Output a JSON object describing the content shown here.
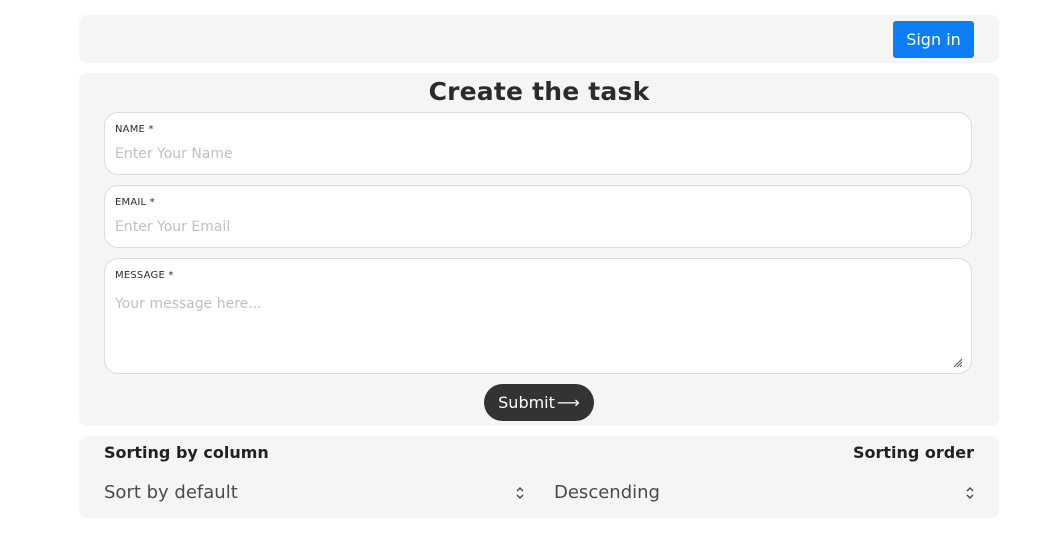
{
  "header": {
    "signin_label": "Sign in"
  },
  "form": {
    "title": "Create the task",
    "name": {
      "label": "NAME *",
      "placeholder": "Enter Your Name",
      "value": ""
    },
    "email": {
      "label": "EMAIL *",
      "placeholder": "Enter Your Email",
      "value": ""
    },
    "message": {
      "label": "MESSAGE *",
      "placeholder": "Your message here...",
      "value": ""
    },
    "submit_label": "Submit",
    "submit_arrow": "⟶"
  },
  "sorting": {
    "column_label": "Sorting by column",
    "column_value": "Sort by default",
    "order_label": "Sorting order",
    "order_value": "Descending"
  },
  "colors": {
    "primary_button": "#0d7ef7",
    "submit_button": "#333333",
    "card_background": "#f5f5f5"
  },
  "icons": [
    "up-down-chevron-icon",
    "resize-grip-icon",
    "arrow-right-icon"
  ]
}
